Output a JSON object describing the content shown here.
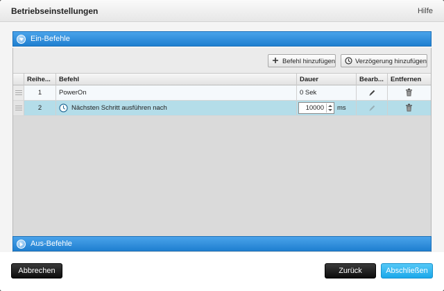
{
  "dialog": {
    "title": "Betriebseinstellungen",
    "help_label": "Hilfe"
  },
  "on_section": {
    "label": "Ein-Befehle",
    "expanded": true
  },
  "off_section": {
    "label": "Aus-Befehle",
    "expanded": false
  },
  "toolbar": {
    "add_command_label": "Befehl hinzufügen",
    "add_delay_label": "Verzögerung hinzufügen"
  },
  "table": {
    "columns": [
      "Reihe...",
      "Befehl",
      "Dauer",
      "Bearb...",
      "Entfernen"
    ],
    "rows": [
      {
        "order": "1",
        "command": "PowerOn",
        "duration": "0 Sek",
        "duration_value": "",
        "duration_unit": "",
        "is_delay": false,
        "selected": false
      },
      {
        "order": "2",
        "command": "Nächsten Schritt ausführen nach",
        "duration": "",
        "duration_value": "10000",
        "duration_unit": "ms",
        "is_delay": true,
        "selected": true
      }
    ]
  },
  "footer": {
    "cancel_label": "Abbrechen",
    "back_label": "Zurück",
    "finish_label": "Abschließen"
  },
  "colors": {
    "section_blue": "#1f7fd0",
    "selected_row": "#b4dde9",
    "finish_button": "#1ba8ea"
  },
  "icons": [
    "collapse-icon",
    "expand-icon",
    "plus-icon",
    "clock-icon",
    "edit-pencil-icon",
    "trash-icon",
    "drag-handle-icon"
  ]
}
